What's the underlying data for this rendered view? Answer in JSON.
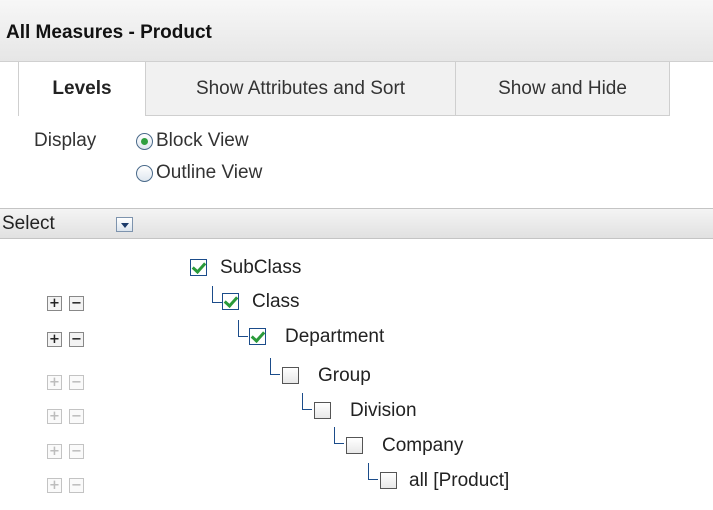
{
  "window": {
    "title": "All Measures - Product"
  },
  "tabs": [
    {
      "label": "Levels",
      "active": true
    },
    {
      "label": "Show Attributes and Sort",
      "active": false
    },
    {
      "label": "Show and Hide",
      "active": false
    }
  ],
  "display": {
    "label": "Display",
    "options": [
      {
        "label": "Block View",
        "selected": true
      },
      {
        "label": "Outline View",
        "selected": false
      }
    ]
  },
  "select_menu": {
    "label": "Select",
    "icon": "dropdown-arrow-icon"
  },
  "levels": [
    {
      "label": "SubClass",
      "checked": true,
      "expand_enabled": null
    },
    {
      "label": "Class",
      "checked": true,
      "expand_enabled": true
    },
    {
      "label": "Department",
      "checked": true,
      "expand_enabled": true
    },
    {
      "label": "Group",
      "checked": false,
      "expand_enabled": false
    },
    {
      "label": "Division",
      "checked": false,
      "expand_enabled": false
    },
    {
      "label": "Company",
      "checked": false,
      "expand_enabled": false
    },
    {
      "label": "all [Product]",
      "checked": false,
      "expand_enabled": false
    }
  ],
  "icons": {
    "expand": "plus-icon",
    "collapse": "minus-icon"
  },
  "colors": {
    "check_green": "#2a9a3a",
    "checkbox_border": "#1b4c8a",
    "header_bg": "#e6e6e6"
  }
}
